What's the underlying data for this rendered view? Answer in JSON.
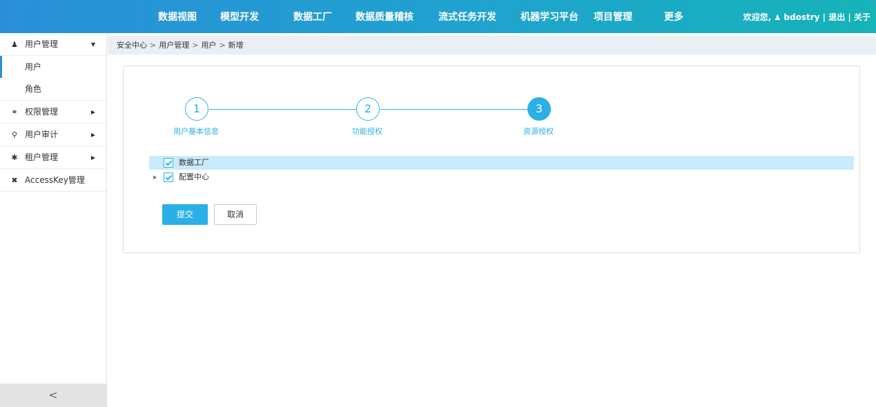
{
  "topnav": {
    "items": [
      "数据视图",
      "模型开发",
      "数据工厂",
      "数据质量稽核",
      "流式任务开发",
      "机器学习平台",
      "项目管理",
      "更多"
    ],
    "welcome": "欢迎您,",
    "username": "bdostry",
    "divider": "|",
    "logout": "退出",
    "about": "关于"
  },
  "sidebar": {
    "groups": [
      {
        "label": "用户管理",
        "icon": "users-icon",
        "arrow": "▼"
      },
      {
        "label": "权限管理",
        "icon": "key-icon",
        "arrow": "▶"
      },
      {
        "label": "用户审计",
        "icon": "search-icon",
        "arrow": "▶"
      },
      {
        "label": "租户管理",
        "icon": "gear-icon",
        "arrow": "▶"
      },
      {
        "label": "AccessKey管理",
        "icon": "wrench-icon"
      }
    ],
    "sub_items": [
      "用户",
      "角色"
    ],
    "collapse": "<"
  },
  "breadcrumb": [
    "安全中心",
    "用户管理",
    "用户",
    "新增"
  ],
  "breadcrumb_sep": ">",
  "steps": [
    {
      "number": "1",
      "label": "用户基本信息"
    },
    {
      "number": "2",
      "label": "功能授权"
    },
    {
      "number": "3",
      "label": "资源授权"
    }
  ],
  "tree": [
    {
      "label": "数据工厂"
    },
    {
      "label": "配置中心"
    }
  ],
  "buttons": {
    "submit": "提交",
    "cancel": "取消"
  },
  "colors": {
    "accent": "#2ab0e6",
    "nav_start": "#2a8fd8",
    "nav_end": "#16b3b8",
    "selected_row": "#c9ebfa"
  }
}
